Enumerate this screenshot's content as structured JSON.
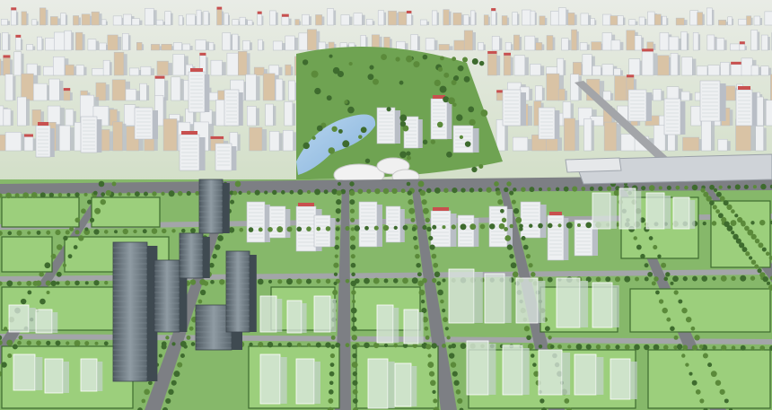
{
  "image": {
    "subject": "architectural-city-model",
    "palette": {
      "sky_haze": "#e9ece6",
      "far_ground": "#a9c497",
      "grass": "#86b86a",
      "grass_light": "#9ccf7c",
      "road": "#7d7f84",
      "road_light": "#a3a5a9",
      "building_white": "#eef0f2",
      "building_shadow": "#b9bec6",
      "building_tan": "#d9c3a5",
      "tower_glass": "#5f6b73",
      "tower_glass_light": "#8f9ba3",
      "water": "#9fc3e3",
      "acrylic": "#dfe9e4",
      "tree": "#3e6b2e",
      "tree_light": "#5b8a3a",
      "roof_red": "#c8504f"
    }
  }
}
